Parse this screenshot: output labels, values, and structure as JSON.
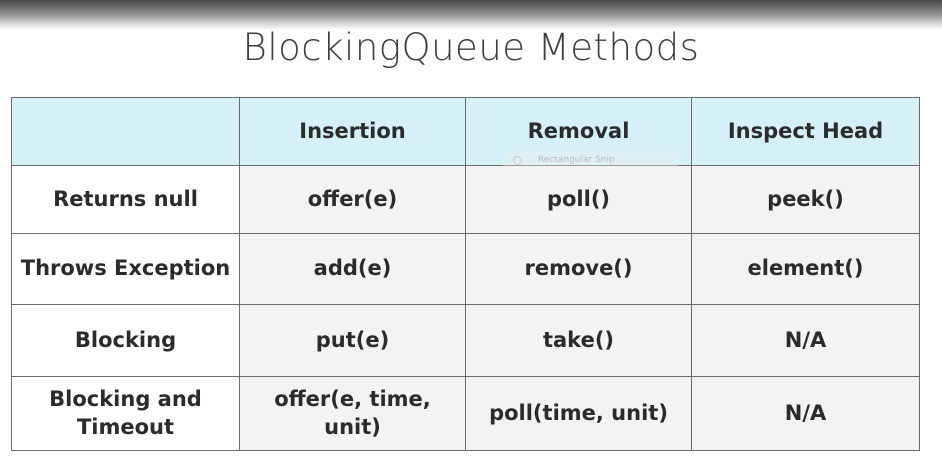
{
  "title": "BlockingQueue Methods",
  "table": {
    "headers": [
      "",
      "Insertion",
      "Removal",
      "Inspect Head"
    ],
    "rows": [
      {
        "label": "Returns null",
        "insertion": "offer(e)",
        "removal": "poll()",
        "inspect": "peek()"
      },
      {
        "label": "Throws Exception",
        "insertion": "add(e)",
        "removal": "remove()",
        "inspect": "element()"
      },
      {
        "label": "Blocking",
        "insertion": "put(e)",
        "removal": "take()",
        "inspect": "N/A"
      },
      {
        "label": "Blocking and Timeout",
        "insertion": "offer(e, time, unit)",
        "removal": "poll(time, unit)",
        "inspect": "N/A"
      }
    ]
  },
  "overlay": {
    "snip_label": "Rectangular Snip",
    "snip_icon": "clock-icon"
  },
  "colors": {
    "header_bg": "#d6f0f8",
    "cell_bg": "#f3f3f3",
    "row_label_bg": "#ffffff",
    "border": "#6b6b6b",
    "title_text": "#3e3e3e"
  }
}
